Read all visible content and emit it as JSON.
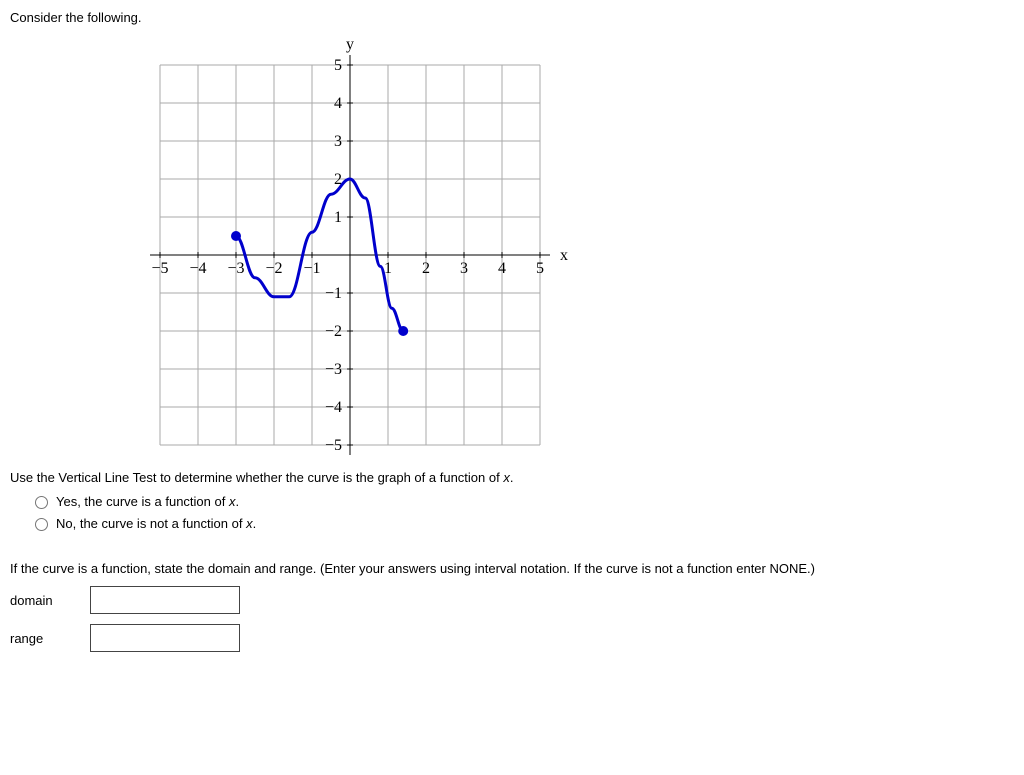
{
  "header": "Consider the following.",
  "chart_data": {
    "type": "line",
    "title": "",
    "xlabel": "x",
    "ylabel": "y",
    "xlim": [
      -5,
      5
    ],
    "ylim": [
      -5,
      5
    ],
    "x_ticks": [
      -5,
      -4,
      -3,
      -2,
      -1,
      1,
      2,
      3,
      4,
      5
    ],
    "y_ticks": [
      -5,
      -4,
      -3,
      -2,
      -1,
      1,
      2,
      3,
      4,
      5
    ],
    "series": [
      {
        "name": "curve",
        "points": [
          {
            "x": -3,
            "y": 0.5,
            "endpoint": true
          },
          {
            "x": -2.5,
            "y": -0.6
          },
          {
            "x": -2,
            "y": -1.1
          },
          {
            "x": -1.6,
            "y": -1.1
          },
          {
            "x": -1,
            "y": 0.6
          },
          {
            "x": -0.5,
            "y": 1.6
          },
          {
            "x": 0,
            "y": 2.0
          },
          {
            "x": 0.4,
            "y": 1.5
          },
          {
            "x": 0.8,
            "y": -0.3
          },
          {
            "x": 1.1,
            "y": -1.4
          },
          {
            "x": 1.4,
            "y": -2.0,
            "endpoint": true
          }
        ]
      }
    ]
  },
  "question1": {
    "text_prefix": "Use the Vertical Line Test to determine whether the curve is the graph of a function of ",
    "text_var": "x",
    "text_suffix": ".",
    "option_yes_prefix": "Yes, the curve is a function of ",
    "option_yes_var": "x",
    "option_yes_suffix": ".",
    "option_no_prefix": "No, the curve is not a function of ",
    "option_no_var": "x",
    "option_no_suffix": "."
  },
  "question2": {
    "text": "If the curve is a function, state the domain and range. (Enter your answers using interval notation. If the curve is not a function enter NONE.)",
    "domain_label": "domain",
    "range_label": "range"
  }
}
